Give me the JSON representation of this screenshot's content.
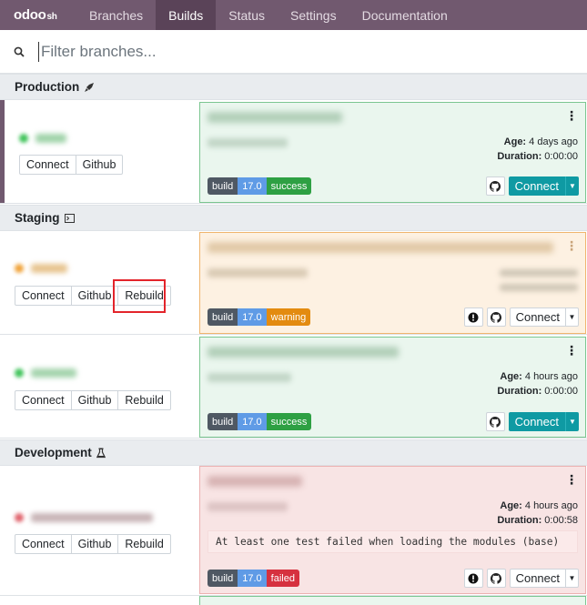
{
  "nav": {
    "brand": "odoo",
    "brand_suffix": "sh",
    "items": [
      {
        "label": "Branches",
        "active": false
      },
      {
        "label": "Builds",
        "active": true
      },
      {
        "label": "Status",
        "active": false
      },
      {
        "label": "Settings",
        "active": false
      },
      {
        "label": "Documentation",
        "active": false
      }
    ]
  },
  "search": {
    "placeholder": "Filter branches...",
    "icon": "search-icon"
  },
  "sections": {
    "production": {
      "label": "Production",
      "icon": "rocket-icon"
    },
    "staging": {
      "label": "Staging",
      "icon": "terminal-icon"
    },
    "development": {
      "label": "Development",
      "icon": "flask-icon"
    }
  },
  "buttons": {
    "connect": "Connect",
    "github": "Github",
    "rebuild": "Rebuild"
  },
  "badges": {
    "build": "build",
    "version": "17.0"
  },
  "labels": {
    "age": "Age:",
    "duration": "Duration:"
  },
  "rows": {
    "production_main": {
      "status": "success",
      "age": "4 days ago",
      "duration": "0:00:00"
    },
    "staging_1": {
      "status": "warning"
    },
    "staging_2": {
      "status": "success",
      "age": "4 hours ago",
      "duration": "0:00:00"
    },
    "dev_1": {
      "status": "failed",
      "age": "4 hours ago",
      "duration": "0:00:58",
      "log": "At least one test failed when loading the modules (base)"
    }
  },
  "colors": {
    "navbar": "#71596f",
    "teal": "#0f9aa3",
    "success": "#2ea043",
    "warning": "#e38b10",
    "failed": "#d6313f"
  }
}
